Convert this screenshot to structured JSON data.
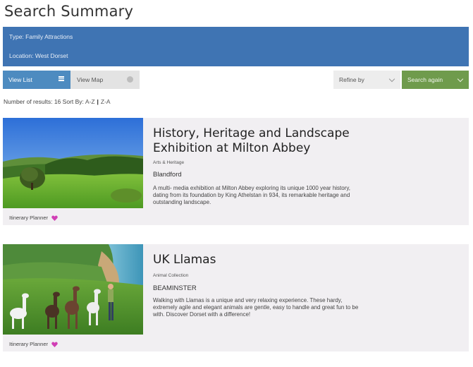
{
  "page": {
    "title": "Search Summary"
  },
  "summary": {
    "type_label": "Type:",
    "type_value": "Family Attractions",
    "location_label": "Location:",
    "location_value": "West Dorset"
  },
  "toolbar": {
    "view_list": "View List",
    "view_map": "View Map",
    "refine_by": "Refine by",
    "search_again": "Search again"
  },
  "results": {
    "count_label": "Number of results:",
    "count": "16",
    "sort_label": "Sort By:",
    "sort_az": "A-Z",
    "sort_za": "Z-A"
  },
  "listings": [
    {
      "title_line1": "History, Heritage and Landscape",
      "title_line2": "Exhibition at Milton Abbey",
      "category": "Arts & Heritage",
      "town": "Blandford",
      "description": "A multi- media exhibition at Milton Abbey exploring its unique 1000 year history, dating from its foundation by King Athelstan in 934, its remarkable heritage and outstanding landscape.",
      "planner_label": "Itinerary Planner"
    },
    {
      "title_line1": "UK Llamas",
      "title_line2": "",
      "category": "Animal Collection",
      "town": "BEAMINSTER",
      "description": "Walking with Llamas is a unique and very relaxing experience. These hardy, extremely agile and elegant animals are gentle, easy to handle and great fun to be with. Discover Dorset with a difference!",
      "planner_label": "Itinerary Planner"
    }
  ],
  "colors": {
    "summary_bg": "#3f74b3",
    "view_list_bg": "#4d8bc0",
    "search_again_bg": "#6f9b4c",
    "card_bg": "#f1eff2",
    "heart": "#d13fb5"
  },
  "icons": {
    "view_list": "list-icon",
    "view_map": "map-pin-icon",
    "refine": "chevron-down-icon",
    "search_again": "chevron-down-icon",
    "planner": "heart-icon"
  }
}
